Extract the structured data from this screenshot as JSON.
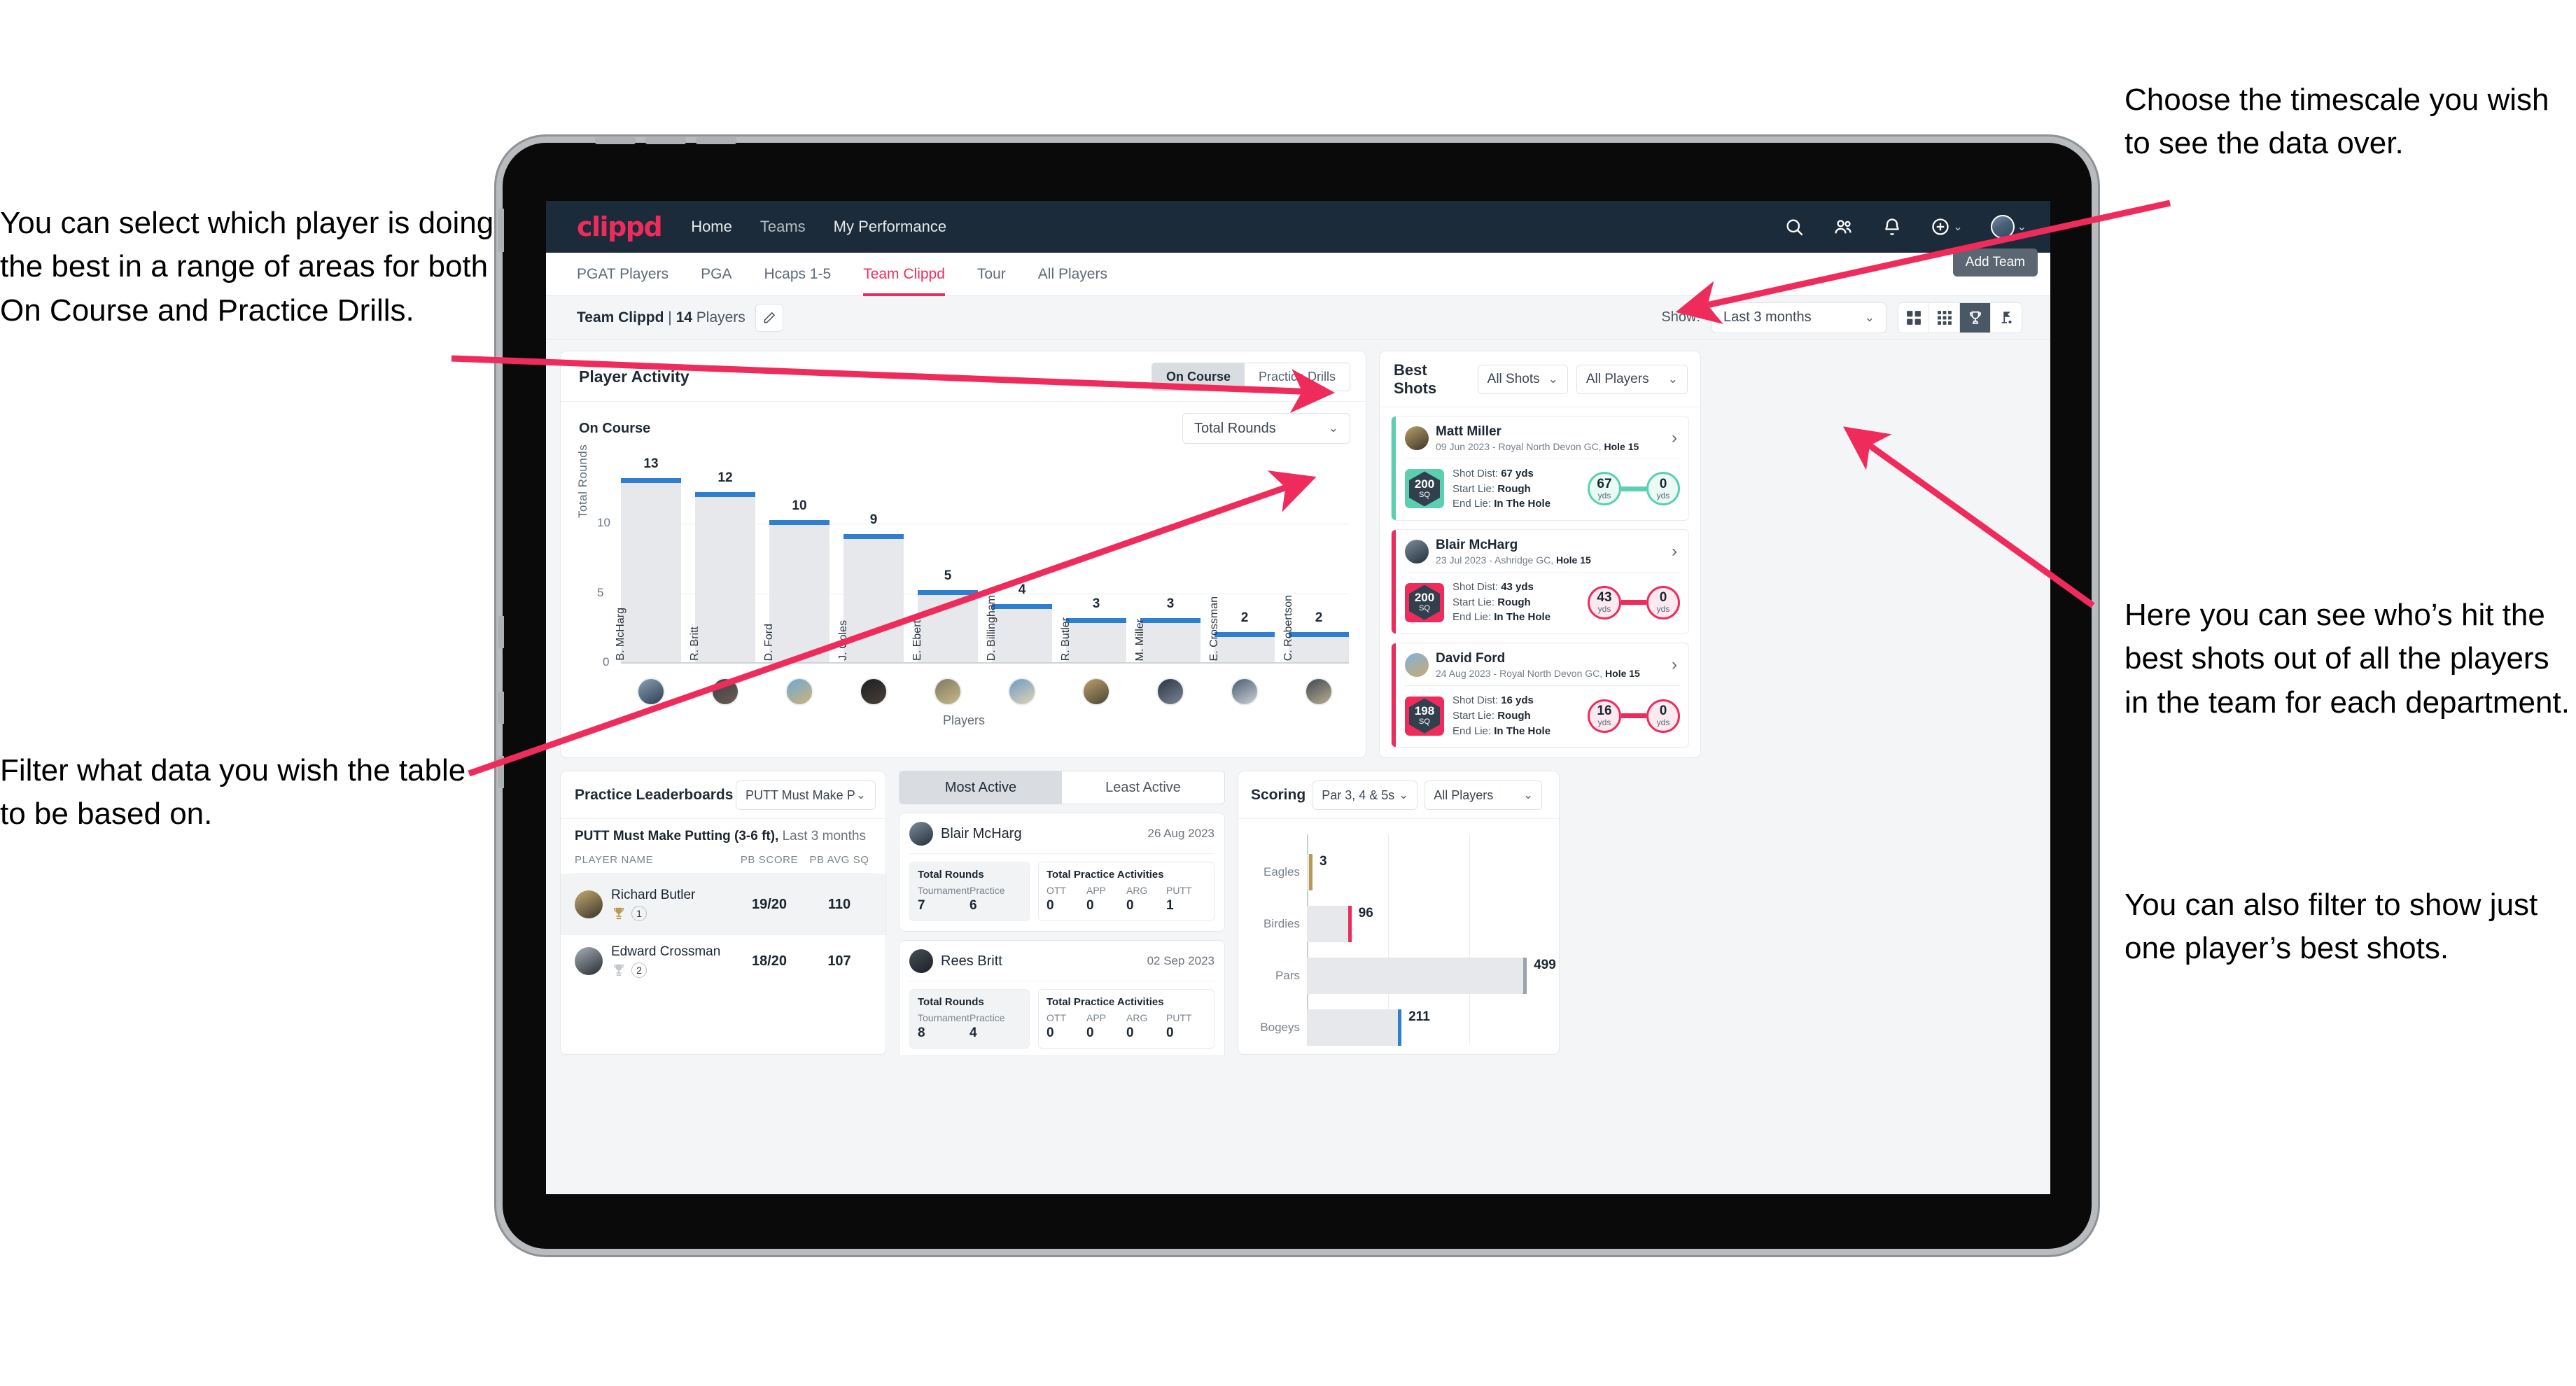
{
  "annotations": {
    "left_top": "You can select which player is doing the best in a range of areas for both On Course and Practice Drills.",
    "left_bottom": "Filter what data you wish the table to be based on.",
    "right_top": "Choose the timescale you wish to see the data over.",
    "right_middle": "Here you can see who’s hit the best shots out of all the players in the team for each department.",
    "right_bottom": "You can also filter to show just one player’s best shots."
  },
  "topnav": {
    "logo": "clippd",
    "links": [
      "Home",
      "Teams",
      "My Performance"
    ],
    "icons": [
      "search-icon",
      "people-icon",
      "bell-icon",
      "plus-circle-icon",
      "avatar"
    ]
  },
  "tabs": {
    "items": [
      "PGAT Players",
      "PGA",
      "Hcaps 1-5",
      "Team Clippd",
      "Tour",
      "All Players"
    ],
    "active": "Team Clippd",
    "tooltip": "Add Team"
  },
  "subbar": {
    "team_name": "Team Clippd",
    "team_count": "14",
    "team_suffix": "Players",
    "show_label": "Show:",
    "timescale": "Last 3 months",
    "views": [
      "grid-large-icon",
      "grid-small-icon",
      "trophy-icon",
      "golf-flag-icon"
    ],
    "active_view": "trophy-icon"
  },
  "player_activity": {
    "title": "Player Activity",
    "segments": [
      "On Course",
      "Practice Drills"
    ],
    "active_segment": "On Course",
    "subtitle": "On Course",
    "metric": "Total Rounds",
    "xlabel": "Players"
  },
  "best_shots": {
    "title": "Best Shots",
    "filter_shots": "All Shots",
    "filter_players": "All Players",
    "cards": [
      {
        "name": "Matt Miller",
        "meta_date": "09 Jun 2023 - Royal North Devon GC,",
        "meta_hole": "Hole 15",
        "sq": "200",
        "sq_unit": "SQ",
        "shot_dist_label": "Shot Dist:",
        "shot_dist": "67 yds",
        "start_lie_label": "Start Lie:",
        "start_lie": "Rough",
        "end_lie_label": "End Lie:",
        "end_lie": "In The Hole",
        "from_val": "67",
        "from_unit": "yds",
        "to_val": "0",
        "to_unit": "yds",
        "accent": "#5ccfb0"
      },
      {
        "name": "Blair McHarg",
        "meta_date": "23 Jul 2023 - Ashridge GC,",
        "meta_hole": "Hole 15",
        "sq": "200",
        "sq_unit": "SQ",
        "shot_dist_label": "Shot Dist:",
        "shot_dist": "43 yds",
        "start_lie_label": "Start Lie:",
        "start_lie": "Rough",
        "end_lie_label": "End Lie:",
        "end_lie": "In The Hole",
        "from_val": "43",
        "from_unit": "yds",
        "to_val": "0",
        "to_unit": "yds",
        "accent": "#ef2b5c"
      },
      {
        "name": "David Ford",
        "meta_date": "24 Aug 2023 - Royal North Devon GC,",
        "meta_hole": "Hole 15",
        "sq": "198",
        "sq_unit": "SQ",
        "shot_dist_label": "Shot Dist:",
        "shot_dist": "16 yds",
        "start_lie_label": "Start Lie:",
        "start_lie": "Rough",
        "end_lie_label": "End Lie:",
        "end_lie": "In The Hole",
        "from_val": "16",
        "from_unit": "yds",
        "to_val": "0",
        "to_unit": "yds",
        "accent": "#ef2b5c"
      }
    ]
  },
  "practice_leaderboards": {
    "title": "Practice Leaderboards",
    "selected_drill": "PUTT Must Make Putting ...",
    "subtitle_bold": "PUTT Must Make Putting (3-6 ft),",
    "subtitle_rest": "Last 3 months",
    "columns": [
      "PLAYER NAME",
      "PB SCORE",
      "PB AVG SQ"
    ],
    "rows": [
      {
        "name": "Richard Butler",
        "rank": "1",
        "pb_score": "19/20",
        "pb_avg_sq": "110",
        "trophy": "gold"
      },
      {
        "name": "Edward Crossman",
        "rank": "2",
        "pb_score": "18/20",
        "pb_avg_sq": "107",
        "trophy": "silver"
      }
    ]
  },
  "activity": {
    "tabs": [
      "Most Active",
      "Least Active"
    ],
    "active_tab": "Most Active",
    "rounds_title": "Total Rounds",
    "rounds_cols": [
      "Tournament",
      "Practice"
    ],
    "practice_title": "Total Practice Activities",
    "practice_cols": [
      "OTT",
      "APP",
      "ARG",
      "PUTT"
    ],
    "cards": [
      {
        "name": "Blair McHarg",
        "date": "26 Aug 2023",
        "tournament": "7",
        "practice": "6",
        "ott": "0",
        "app": "0",
        "arg": "0",
        "putt": "1"
      },
      {
        "name": "Rees Britt",
        "date": "02 Sep 2023",
        "tournament": "8",
        "practice": "4",
        "ott": "0",
        "app": "0",
        "arg": "0",
        "putt": "0"
      }
    ]
  },
  "scoring": {
    "title": "Scoring",
    "filter_par": "Par 3, 4 & 5s",
    "filter_players": "All Players"
  },
  "chart_data": [
    {
      "type": "bar",
      "title": "Player Activity - On Course",
      "xlabel": "Players",
      "ylabel": "Total Rounds",
      "ylim": [
        0,
        14
      ],
      "yticks": [
        0,
        5,
        10
      ],
      "grid": true,
      "categories": [
        "B. McHarg",
        "R. Britt",
        "D. Ford",
        "J. Coles",
        "E. Ebert",
        "D. Billingham",
        "R. Butler",
        "M. Miller",
        "E. Crossman",
        "C. Robertson"
      ],
      "values": [
        13,
        12,
        10,
        9,
        5,
        4,
        3,
        3,
        2,
        2
      ],
      "bar_color": "#e6e8ec",
      "cap_color": "#2f7fd1"
    },
    {
      "type": "bar",
      "orientation": "horizontal",
      "title": "Scoring",
      "categories": [
        "Eagles",
        "Birdies",
        "Pars",
        "Bogeys"
      ],
      "values": [
        3,
        96,
        499,
        211
      ],
      "xlim": [
        0,
        560
      ],
      "cap_colors": [
        "#b59b55",
        "#ef2b5c",
        "#9aa2ab",
        "#2f7fd1"
      ],
      "bar_color": "#e6e8ec",
      "grid": true
    }
  ]
}
